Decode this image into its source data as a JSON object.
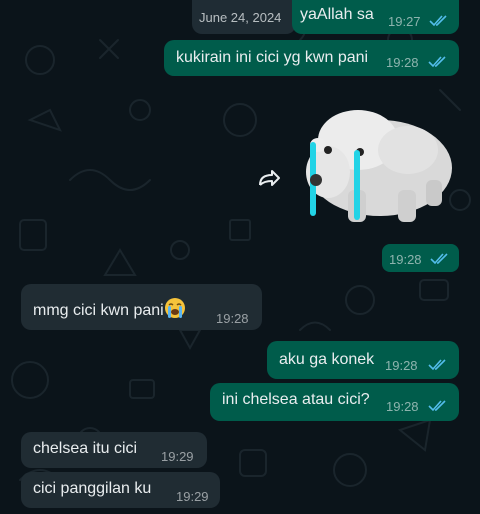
{
  "chat": {
    "date_label": "June 24, 2024",
    "messages": [
      {
        "id": "m1",
        "direction": "outgoing",
        "text": "yaAllah sa",
        "time": "19:27",
        "status": "read"
      },
      {
        "id": "m2",
        "direction": "outgoing",
        "text": "kukirain ini cici yg kwn pani",
        "time": "19:28",
        "status": "read"
      },
      {
        "id": "m3",
        "direction": "outgoing",
        "type": "sticker",
        "sticker": "crying-polar-bear-sticker",
        "time": "19:28",
        "status": "read"
      },
      {
        "id": "m4",
        "direction": "incoming",
        "text": "mmg cici kwn pani",
        "emoji": "loudly-crying-face",
        "time": "19:28"
      },
      {
        "id": "m5",
        "direction": "outgoing",
        "text": "aku ga konek",
        "time": "19:28",
        "status": "read"
      },
      {
        "id": "m6",
        "direction": "outgoing",
        "text": "ini chelsea atau cici?",
        "time": "19:28",
        "status": "read"
      },
      {
        "id": "m7",
        "direction": "incoming",
        "text": "chelsea itu cici",
        "time": "19:29"
      },
      {
        "id": "m8",
        "direction": "incoming",
        "text": "cici panggilan ku",
        "time": "19:29"
      }
    ]
  },
  "icons": {
    "read_ticks": "double-check-icon",
    "forward": "forward-arrow-icon"
  },
  "colors": {
    "background": "#0b141a",
    "outgoing_bubble": "#005c4b",
    "incoming_bubble": "#202c33",
    "read_ticks": "#53bdeb",
    "text": "#e9edef"
  }
}
